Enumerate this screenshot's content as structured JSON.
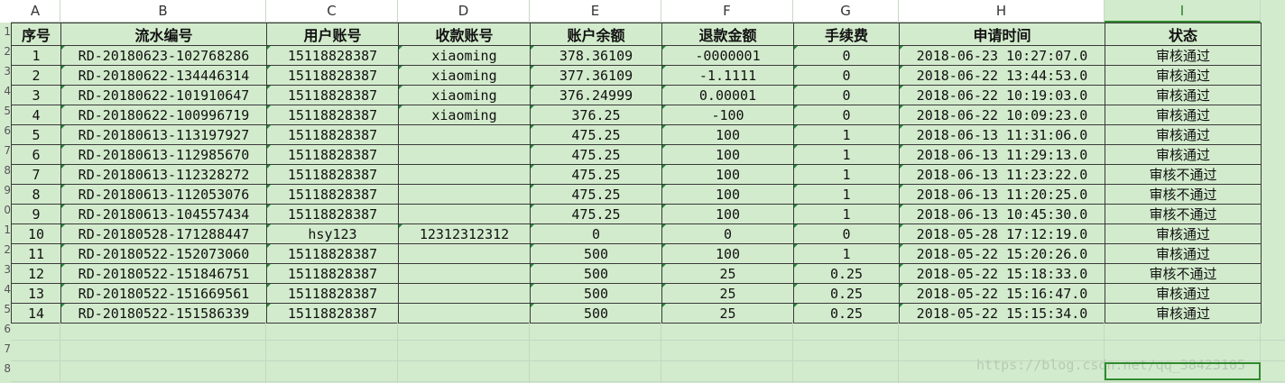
{
  "column_letters": [
    "A",
    "B",
    "C",
    "D",
    "E",
    "F",
    "G",
    "H",
    "I"
  ],
  "row_numbers": [
    "1",
    "2",
    "3",
    "4",
    "5",
    "6",
    "7",
    "8",
    "9",
    "0",
    "1",
    "2",
    "3",
    "4",
    "5",
    "6",
    "7",
    "8"
  ],
  "headers": [
    "序号",
    "流水编号",
    "用户账号",
    "收款账号",
    "账户余额",
    "退款金额",
    "手续费",
    "申请时间",
    "状态"
  ],
  "rows": [
    [
      "1",
      "RD-20180623-102768286",
      "15118828387",
      "xiaoming",
      "378.36109",
      "-0000001",
      "0",
      "2018-06-23 10:27:07.0",
      "审核通过"
    ],
    [
      "2",
      "RD-20180622-134446314",
      "15118828387",
      "xiaoming",
      "377.36109",
      "-1.1111",
      "0",
      "2018-06-22 13:44:53.0",
      "审核通过"
    ],
    [
      "3",
      "RD-20180622-101910647",
      "15118828387",
      "xiaoming",
      "376.24999",
      "0.00001",
      "0",
      "2018-06-22 10:19:03.0",
      "审核通过"
    ],
    [
      "4",
      "RD-20180622-100996719",
      "15118828387",
      "xiaoming",
      "376.25",
      "-100",
      "0",
      "2018-06-22 10:09:23.0",
      "审核通过"
    ],
    [
      "5",
      "RD-20180613-113197927",
      "15118828387",
      "",
      "475.25",
      "100",
      "1",
      "2018-06-13 11:31:06.0",
      "审核通过"
    ],
    [
      "6",
      "RD-20180613-112985670",
      "15118828387",
      "",
      "475.25",
      "100",
      "1",
      "2018-06-13 11:29:13.0",
      "审核通过"
    ],
    [
      "7",
      "RD-20180613-112328272",
      "15118828387",
      "",
      "475.25",
      "100",
      "1",
      "2018-06-13 11:23:22.0",
      "审核不通过"
    ],
    [
      "8",
      "RD-20180613-112053076",
      "15118828387",
      "",
      "475.25",
      "100",
      "1",
      "2018-06-13 11:20:25.0",
      "审核不通过"
    ],
    [
      "9",
      "RD-20180613-104557434",
      "15118828387",
      "",
      "475.25",
      "100",
      "1",
      "2018-06-13 10:45:30.0",
      "审核不通过"
    ],
    [
      "10",
      "RD-20180528-171288447",
      "hsy123",
      "12312312312",
      "0",
      "0",
      "0",
      "2018-05-28 17:12:19.0",
      "审核通过"
    ],
    [
      "11",
      "RD-20180522-152073060",
      "15118828387",
      "",
      "500",
      "100",
      "1",
      "2018-05-22 15:20:26.0",
      "审核通过"
    ],
    [
      "12",
      "RD-20180522-151846751",
      "15118828387",
      "",
      "500",
      "25",
      "0.25",
      "2018-05-22 15:18:33.0",
      "审核不通过"
    ],
    [
      "13",
      "RD-20180522-151669561",
      "15118828387",
      "",
      "500",
      "25",
      "0.25",
      "2018-05-22 15:16:47.0",
      "审核通过"
    ],
    [
      "14",
      "RD-20180522-151586339",
      "15118828387",
      "",
      "500",
      "25",
      "0.25",
      "2018-05-22 15:15:34.0",
      "审核通过"
    ]
  ],
  "watermark": "https://blog.csdn.net/qq_38423105",
  "colors": {
    "sheet_bg": "#d3ebcd",
    "selection": "#2e8b2e",
    "indicator": "#1f8a3a"
  }
}
